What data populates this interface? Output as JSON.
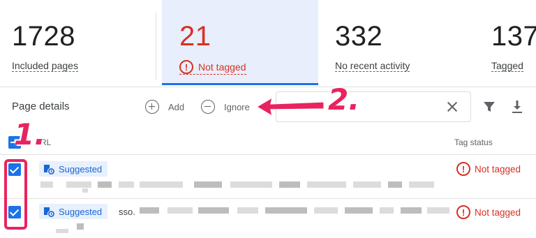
{
  "stats": {
    "included": {
      "value": "1728",
      "label": "Included pages"
    },
    "not_tagged": {
      "value": "21",
      "label": "Not tagged"
    },
    "no_activity": {
      "value": "332",
      "label": "No recent activity"
    },
    "tagged": {
      "value": "137",
      "label": "Tagged"
    }
  },
  "toolbar": {
    "title": "Page details",
    "add_label": "Add",
    "ignore_label": "Ignore",
    "search_value": ""
  },
  "table": {
    "headers": {
      "url": "RL",
      "tag_status": "Tag status"
    },
    "rows": [
      {
        "chip": "Suggested",
        "url_prefix": "",
        "status": "Not tagged"
      },
      {
        "chip": "Suggested",
        "url_prefix": "sso.",
        "status": "Not tagged"
      }
    ]
  },
  "annotations": {
    "one": "1.",
    "two": "2."
  },
  "colors": {
    "accent": "#1a73e8",
    "error": "#d93025",
    "highlight": "#e8245f",
    "selected_card_bg": "#e8eefb"
  },
  "icons": [
    "error-icon",
    "add-circle-icon",
    "remove-circle-icon",
    "clear-icon",
    "filter-icon",
    "download-icon",
    "tag-icon",
    "checkbox-icon"
  ]
}
